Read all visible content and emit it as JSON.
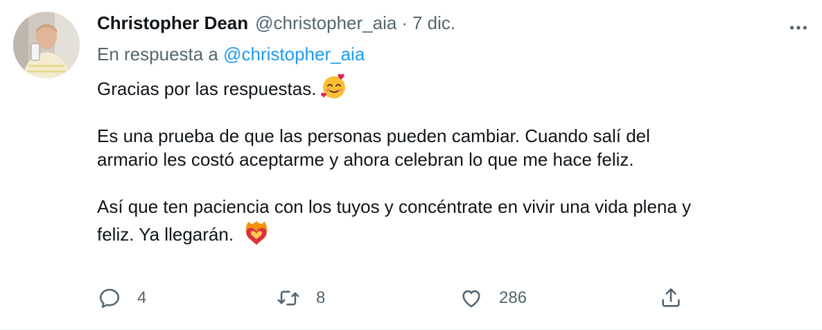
{
  "author": {
    "name": "Christopher Dean",
    "handle": "@christopher_aia",
    "separator": "·",
    "date": "7 dic."
  },
  "reply_to": {
    "prefix": "En respuesta a",
    "mention": "@christopher_aia"
  },
  "body": {
    "line1": "Gracias por las respuestas.",
    "line1_emoji": "smiling-face-with-hearts-emoji",
    "paragraph2": "Es una prueba de que las personas pueden cambiar. Cuando salí del",
    "paragraph2b": "armario les costó aceptarme y ahora celebran lo que me hace feliz.",
    "paragraph3": "Así que ten paciencia con los tuyos y concéntrate en vivir una vida plena y",
    "paragraph3b": "feliz. Ya llegarán.",
    "paragraph3_emoji": "heart-on-fire-emoji"
  },
  "actions": {
    "reply_count": "4",
    "retweet_count": "8",
    "like_count": "286"
  },
  "colors": {
    "text_primary": "#0f1419",
    "text_secondary": "#536471",
    "link": "#1d9bf0"
  }
}
